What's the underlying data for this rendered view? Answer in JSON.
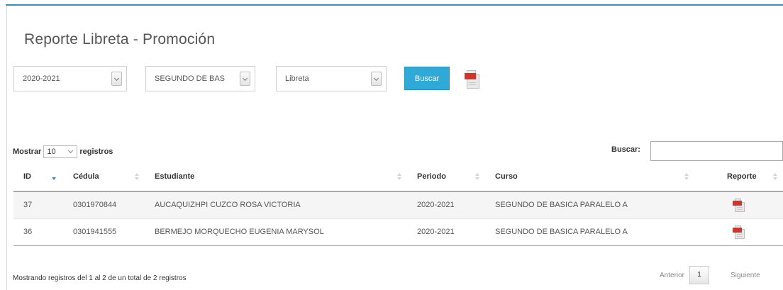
{
  "title": "Reporte Libreta - Promoción",
  "filters": {
    "periodo": "2020-2021",
    "curso": "SEGUNDO DE BAS",
    "tipo": "Libreta",
    "search_button": "Buscar"
  },
  "datatable": {
    "length_prefix": "Mostrar",
    "length_value": "10",
    "length_suffix": "registros",
    "search_label": "Buscar:",
    "search_value": "",
    "columns": [
      "ID",
      "Cédula",
      "Estudiante",
      "Periodo",
      "Curso",
      "Reporte"
    ],
    "rows": [
      {
        "id": "37",
        "cedula": "0301970844",
        "estudiante": "AUCAQUIZHPI CUZCO ROSA VICTORIA",
        "periodo": "2020-2021",
        "curso": "SEGUNDO DE BASICA PARALELO A"
      },
      {
        "id": "36",
        "cedula": "0301941555",
        "estudiante": "BERMEJO MORQUECHO EUGENIA MARYSOL",
        "periodo": "2020-2021",
        "curso": "SEGUNDO DE BASICA PARALELO A"
      }
    ],
    "info": "Mostrando registros del 1 al 2 de un total de 2 registros",
    "pagination": {
      "previous": "Anterior",
      "current": "1",
      "next": "Siguiente"
    }
  },
  "icons": {
    "report": "pdf-icon",
    "sort": "sort-icon",
    "dropdown": "chevron-down-icon"
  },
  "colors": {
    "accent": "#2fa9d8",
    "top_bar": "#3c8dbc",
    "pdf_red": "#d8312a",
    "sort_active": "#4e86d4"
  }
}
